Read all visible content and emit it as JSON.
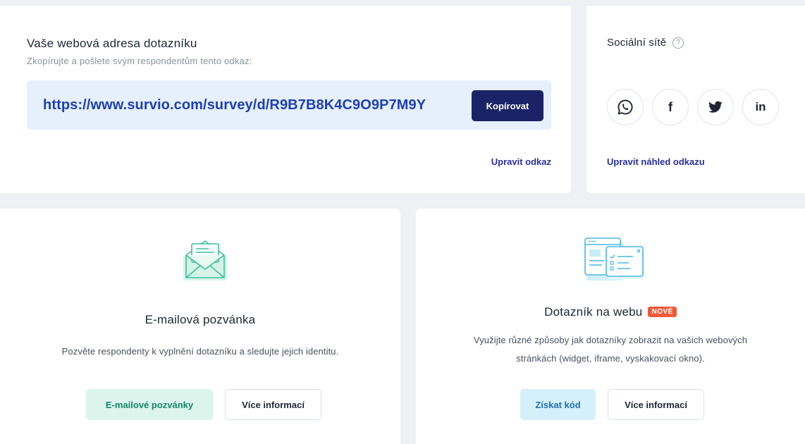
{
  "share": {
    "title": "Vaše webová adresa dotazníku",
    "subtitle": "Zkopírujte a pošlete svým respondentům tento odkaz:",
    "url": "https://www.survio.com/survey/d/R9B7B8K4C9O9P7M9Y",
    "copy_label": "Kopírovat",
    "edit_link_label": "Upravit odkaz"
  },
  "social": {
    "title": "Sociální sítě",
    "help_glyph": "?",
    "networks": [
      {
        "name": "WhatsApp",
        "icon": "whatsapp-icon"
      },
      {
        "name": "Facebook",
        "icon": "facebook-icon",
        "glyph": "f"
      },
      {
        "name": "Twitter",
        "icon": "twitter-icon"
      },
      {
        "name": "LinkedIn",
        "icon": "linkedin-icon",
        "glyph": "in"
      }
    ],
    "edit_preview_label": "Upravit náhled odkazu"
  },
  "email_invite": {
    "icon": "envelope-icon",
    "heading": "E-mailová pozvánka",
    "description": "Pozvěte respondenty k vyplnění dotazníku a sledujte jejich identitu.",
    "primary_label": "E-mailové pozvánky",
    "secondary_label": "Více informací"
  },
  "web_survey": {
    "icon": "browser-windows-icon",
    "heading": "Dotazník na webu",
    "badge": "NOVÉ",
    "description_line1": "Využijte různé způsoby jak dotazníky zobrazit na vašich webových",
    "description_line2": "stránkách (widget, iframe, vyskakovací okno).",
    "primary_label": "Získat kód",
    "secondary_label": "Více informací"
  },
  "colors": {
    "background": "#eef0f4",
    "url_box": "#e6effc",
    "url_text": "#1c3fb8",
    "copy_button": "#1b2366",
    "link": "#2a2fa3",
    "green_button": "#dcf5ec",
    "cyan_button": "#d5f0fb",
    "badge": "#ef5a3a"
  }
}
